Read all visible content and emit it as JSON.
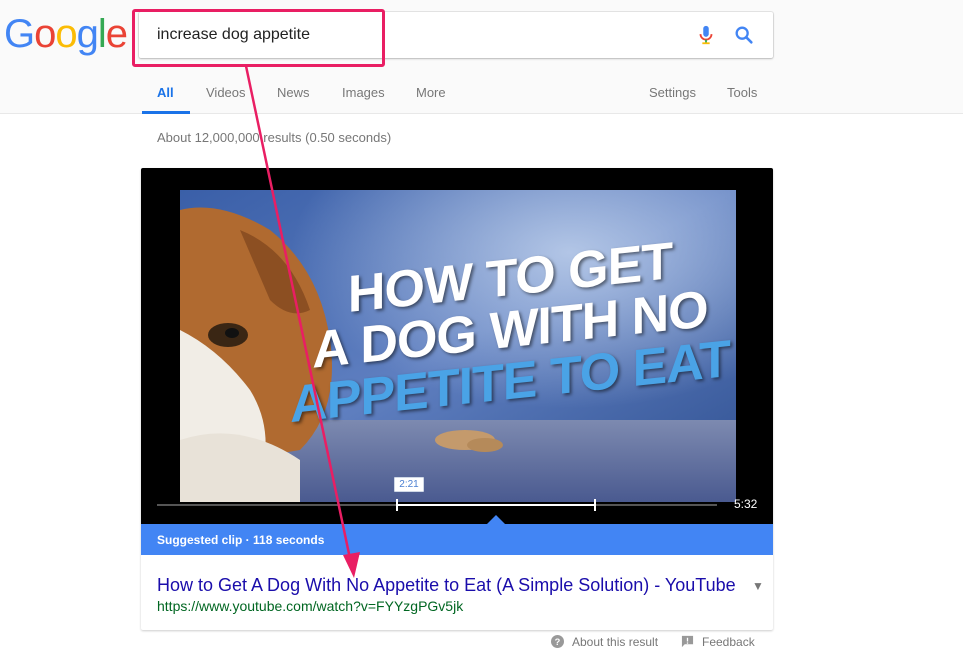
{
  "logo": {
    "letters": [
      "G",
      "o",
      "o",
      "g",
      "l",
      "e"
    ]
  },
  "search": {
    "query": "increase dog appetite"
  },
  "tabs": {
    "all": "All",
    "videos": "Videos",
    "news": "News",
    "images": "Images",
    "more": "More",
    "settings": "Settings",
    "tools": "Tools"
  },
  "stats": "About 12,000,000 results (0.50 seconds)",
  "video": {
    "thumbnail_text": [
      "HOW TO GET",
      "A DOG WITH NO",
      "APPETITE TO EAT"
    ],
    "clip_start": "2:21",
    "duration": "5:32"
  },
  "suggested": "Suggested clip · 118 seconds",
  "result": {
    "title": "How to Get A Dog With No Appetite to Eat (A Simple Solution) - YouTube",
    "url": "https://www.youtube.com/watch?v=FYYzgPGv5jk"
  },
  "footer": {
    "about": "About this result",
    "feedback": "Feedback"
  },
  "colors": {
    "accent_blue": "#4285f4",
    "link": "#1a0dab",
    "url_green": "#006621",
    "annotation_pink": "#e91e63"
  }
}
